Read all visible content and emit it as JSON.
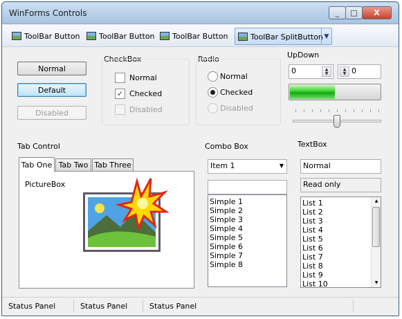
{
  "window": {
    "title": "WinForms Controls"
  },
  "titlebar": {
    "minimize_glyph": "_",
    "maximize_glyph": "□",
    "close_glyph": "X"
  },
  "toolbar": {
    "buttons": [
      {
        "label": "ToolBar Button",
        "icon": "image-icon"
      },
      {
        "label": "ToolBar Button",
        "icon": "image-icon"
      },
      {
        "label": "ToolBar Button",
        "icon": "image-icon"
      }
    ],
    "split_button": {
      "label": "ToolBar SplitButton",
      "icon": "image-icon",
      "arrow": "▼"
    }
  },
  "buttons": {
    "normal": "Normal",
    "default": "Default",
    "disabled": "Disabled"
  },
  "checkbox_group": {
    "title": "CheckBox",
    "items": [
      {
        "label": "Normal",
        "checked": false,
        "enabled": true
      },
      {
        "label": "Checked",
        "checked": true,
        "enabled": true,
        "mark": "✓"
      },
      {
        "label": "Disabled",
        "checked": false,
        "enabled": false
      }
    ]
  },
  "radio_group": {
    "title": "Radio",
    "items": [
      {
        "label": "Normal",
        "selected": false,
        "enabled": true
      },
      {
        "label": "Checked",
        "selected": true,
        "enabled": true
      },
      {
        "label": "Disabled",
        "selected": false,
        "enabled": false
      }
    ]
  },
  "updown": {
    "title": "UpDown",
    "value1": "0",
    "value2": "0",
    "up": "▲",
    "down": "▼"
  },
  "progress": {
    "value_fraction": 0.5,
    "color": "#2ecc2e"
  },
  "slider": {
    "value_fraction": 0.5,
    "tick_count": 11
  },
  "tab_control": {
    "title": "Tab Control",
    "tabs": [
      "Tab One",
      "Tab Two",
      "Tab Three"
    ],
    "active_tab": "Tab One",
    "picturebox_label": "PictureBox"
  },
  "combo": {
    "title": "Combo Box",
    "selected": "Item 1",
    "arrow": "▼",
    "simple_value": "",
    "simple_items": [
      "Simple 1",
      "Simple 2",
      "Simple 3",
      "Simple 4",
      "Simple 5",
      "Simple 6",
      "Simple 7",
      "Simple 8"
    ]
  },
  "textbox": {
    "title": "TextBox",
    "normal": "Normal",
    "readonly": "Read only",
    "list_items": [
      "List 1",
      "List 2",
      "List 3",
      "List 4",
      "List 5",
      "List 6",
      "List 7",
      "List 8",
      "List 9",
      "List 10"
    ],
    "scroll_up": "▲",
    "scroll_down": "▼"
  },
  "statusbar": {
    "panels": [
      "Status Panel",
      "Status Panel",
      "Status Panel"
    ]
  }
}
